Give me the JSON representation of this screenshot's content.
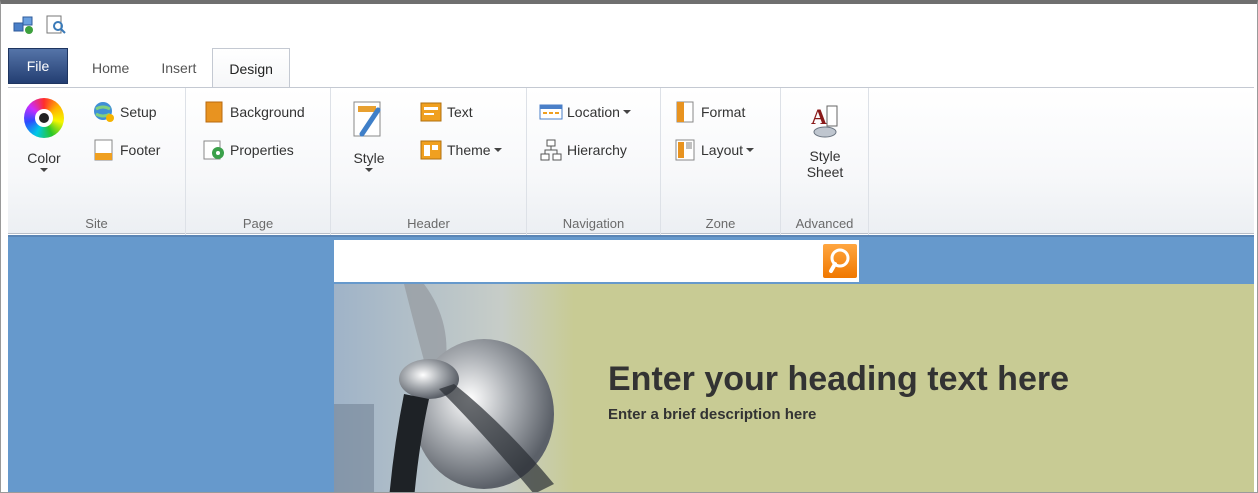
{
  "quick_access": {
    "icons": [
      "network-settings-icon",
      "preview-icon"
    ]
  },
  "tabs": [
    {
      "label": "File"
    },
    {
      "label": "Home"
    },
    {
      "label": "Insert"
    },
    {
      "label": "Design"
    }
  ],
  "ribbon": {
    "site": {
      "label": "Site",
      "color": "Color",
      "setup": "Setup",
      "footer": "Footer"
    },
    "page": {
      "label": "Page",
      "background": "Background",
      "properties": "Properties"
    },
    "header": {
      "label": "Header",
      "style": "Style",
      "text": "Text",
      "theme": "Theme"
    },
    "navigation": {
      "label": "Navigation",
      "location": "Location",
      "hierarchy": "Hierarchy"
    },
    "zone": {
      "label": "Zone",
      "format": "Format",
      "layout": "Layout"
    },
    "advanced": {
      "label": "Advanced",
      "style_sheet_line1": "Style",
      "style_sheet_line2": "Sheet"
    }
  },
  "page": {
    "heading": "Enter your heading text here",
    "description": "Enter a brief description here"
  },
  "colors": {
    "canvas": "#6699cc",
    "banner": "#c8cb94",
    "search_button": "#f07800",
    "file_tab": "#2b4a80"
  }
}
